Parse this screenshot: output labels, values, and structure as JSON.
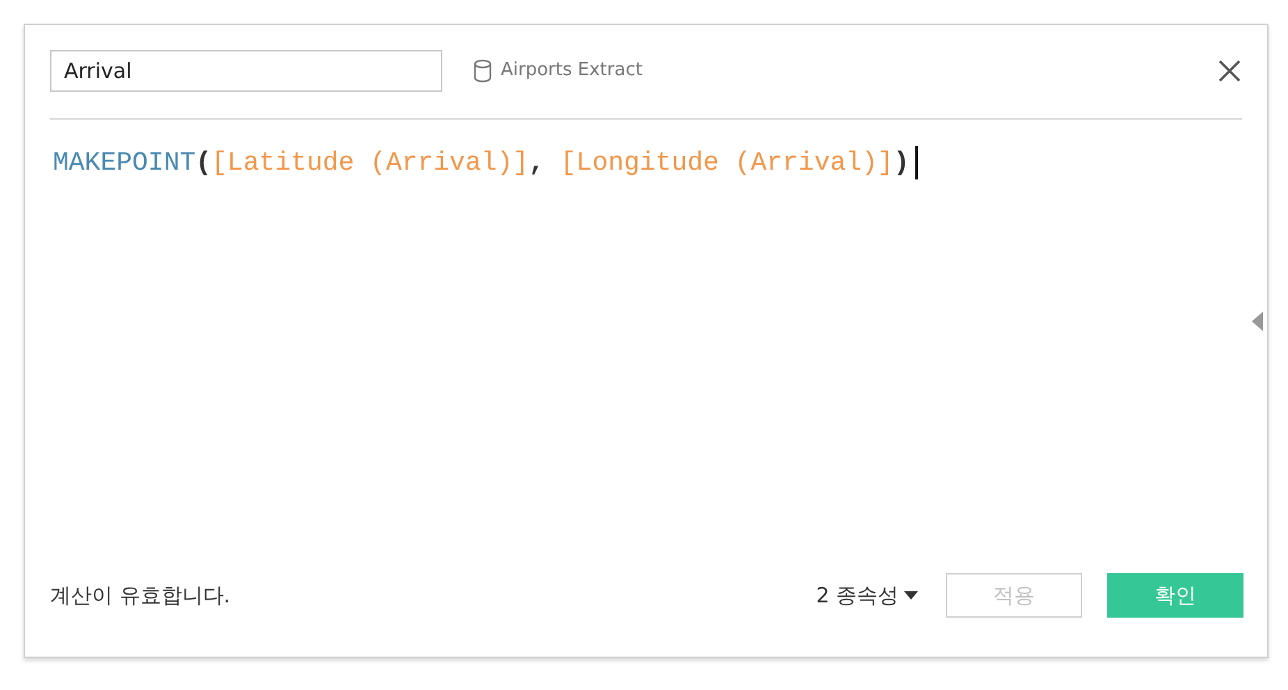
{
  "name_field": {
    "value": "Arrival"
  },
  "data_source": "Airports Extract",
  "formula": [
    {
      "kind": "function",
      "text": "MAKEPOINT"
    },
    {
      "kind": "punct",
      "text": "("
    },
    {
      "kind": "field",
      "text": "[Latitude (Arrival)]"
    },
    {
      "kind": "punct",
      "text": ", "
    },
    {
      "kind": "field",
      "text": "[Longitude (Arrival)]"
    },
    {
      "kind": "punct",
      "text": ")"
    }
  ],
  "status": "계산이 유효합니다.",
  "dependencies": "2 종속성",
  "buttons": [
    {
      "label": "적용",
      "disabled": true,
      "kind": "secondary"
    },
    {
      "label": "확인",
      "disabled": false,
      "kind": "primary"
    }
  ]
}
